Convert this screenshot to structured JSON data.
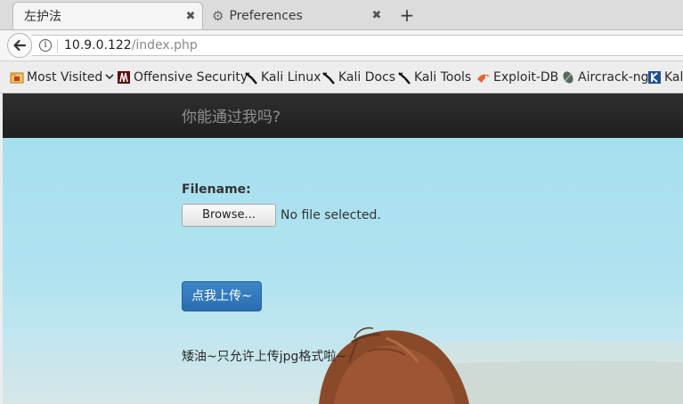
{
  "browser": {
    "tabs": [
      {
        "label": "左护法",
        "active": true
      },
      {
        "label": "Preferences",
        "active": false,
        "icon": "gear-icon"
      }
    ],
    "new_tab_symbol": "+",
    "close_symbol": "✖",
    "url_host": "10.9.0.122",
    "url_path": "/index.php"
  },
  "bookmarks": [
    {
      "label": "Most Visited",
      "icon": "folder-icon",
      "dropdown": true
    },
    {
      "label": "Offensive Security",
      "icon": "offsec-icon"
    },
    {
      "label": "Kali Linux",
      "icon": "kali-dragon-icon"
    },
    {
      "label": "Kali Docs",
      "icon": "kali-dragon-icon"
    },
    {
      "label": "Kali Tools",
      "icon": "kali-dragon-icon"
    },
    {
      "label": "Exploit-DB",
      "icon": "exploit-db-icon"
    },
    {
      "label": "Aircrack-ng",
      "icon": "aircrack-icon"
    },
    {
      "label": "Kali",
      "icon": "kali-k-icon"
    }
  ],
  "page": {
    "brand": "你能通过我吗?",
    "field_label": "Filename:",
    "browse_label": "Browse...",
    "no_file_text": "No file selected.",
    "submit_label": "点我上传~",
    "hint": "矮油~只允许上传jpg格式啦~"
  },
  "colors": {
    "header_bg": "#262626",
    "hero_sky": "#a6dfee",
    "submit_bg": "#337ab7"
  }
}
